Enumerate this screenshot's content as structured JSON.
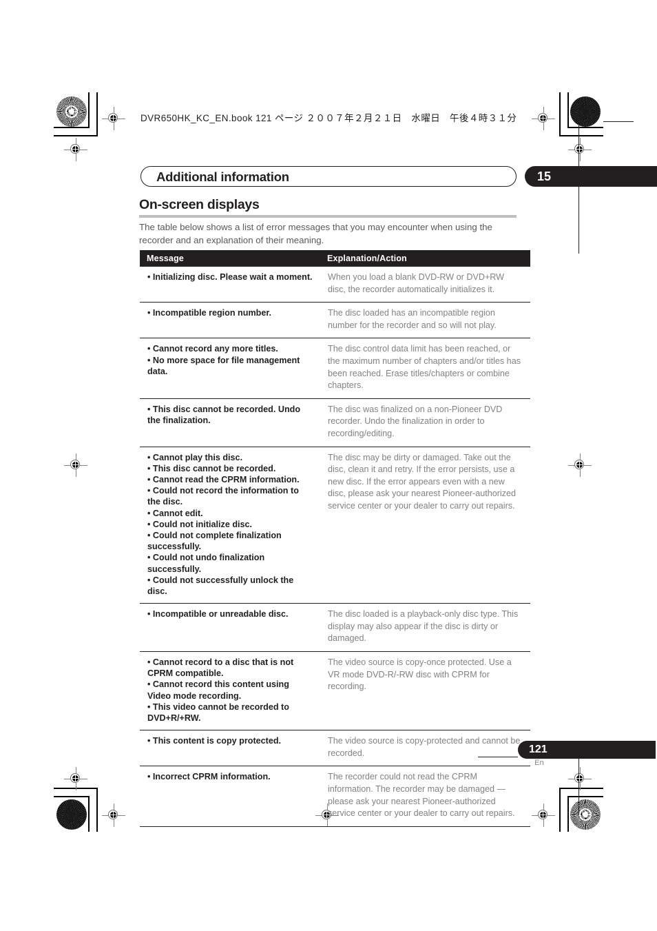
{
  "print_header": "DVR650HK_KC_EN.book  121 ページ  ２００７年２月２１日　水曜日　午後４時３１分",
  "chapter": {
    "title": "Additional information",
    "number": "15"
  },
  "section": {
    "heading": "On-screen displays",
    "intro": "The table below shows a list of error messages that you may encounter when using the recorder and an explanation of their meaning."
  },
  "table": {
    "headers": {
      "message": "Message",
      "explanation": "Explanation/Action"
    },
    "rows": [
      {
        "messages": [
          "• Initializing disc. Please wait a moment."
        ],
        "explanation": "When you load a blank DVD-RW or DVD+RW disc, the recorder automatically initializes it."
      },
      {
        "messages": [
          "• Incompatible region number."
        ],
        "explanation": "The disc loaded has an incompatible region number for the recorder and so will not play."
      },
      {
        "messages": [
          "• Cannot record any more titles.",
          "• No more space for file management data."
        ],
        "explanation": "The disc control data limit has been reached, or the maximum number of chapters and/or titles has been reached. Erase titles/chapters or combine chapters."
      },
      {
        "messages": [
          "• This disc cannot be recorded. Undo the finalization."
        ],
        "explanation": "The disc was finalized on a non-Pioneer DVD recorder. Undo the finalization in order to recording/editing."
      },
      {
        "messages": [
          "• Cannot play this disc.",
          "• This disc cannot be recorded.",
          "• Cannot read the CPRM information.",
          "• Could not record the information to the disc.",
          "• Cannot edit.",
          "• Could not initialize disc.",
          "• Could not complete finalization successfully.",
          "• Could not undo finalization successfully.",
          "• Could not successfully unlock the disc."
        ],
        "explanation": "The disc may be dirty or damaged. Take out the disc, clean it and retry. If the error persists, use a new disc. If the error appears even with a new disc, please ask your nearest Pioneer-authorized service center or your dealer to carry out repairs."
      },
      {
        "messages": [
          "• Incompatible or unreadable disc."
        ],
        "explanation": "The disc loaded is a playback-only disc type. This display may also appear if the disc is dirty or damaged."
      },
      {
        "messages": [
          "• Cannot record to a disc that is not CPRM compatible.",
          "• Cannot record this content using Video mode recording.",
          "• This video cannot be recorded to DVD+R/+RW."
        ],
        "explanation": "The video source is copy-once protected. Use a VR mode DVD-R/-RW disc with CPRM for recording."
      },
      {
        "messages": [
          "• This content is copy protected."
        ],
        "explanation": "The video source is copy-protected and cannot be recorded."
      },
      {
        "messages": [
          "• Incorrect CPRM information."
        ],
        "explanation": "The recorder could not read the CPRM information. The recorder may be damaged — please ask your nearest Pioneer-authorized service center or your dealer to carry out repairs."
      }
    ]
  },
  "footer": {
    "page_number": "121",
    "language": "En"
  }
}
